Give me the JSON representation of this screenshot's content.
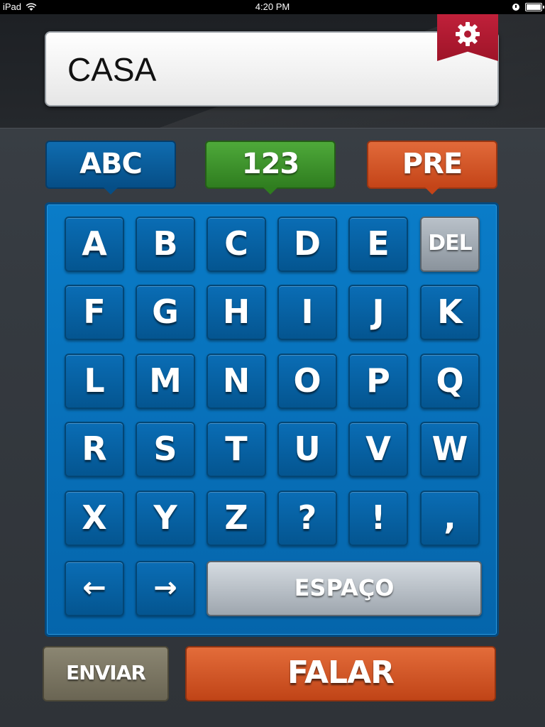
{
  "status_bar": {
    "device": "iPad",
    "time": "4:20 PM"
  },
  "display": {
    "text": "CASA"
  },
  "icons": {
    "settings": "gear-icon",
    "wifi": "wifi-icon",
    "battery": "battery-icon",
    "lock_rotation": "rotation-lock-icon"
  },
  "tabs": [
    {
      "label": "ABC",
      "color": "#0a6db5"
    },
    {
      "label": "123",
      "color": "#3f9a2d"
    },
    {
      "label": "PRE",
      "color": "#d55628"
    }
  ],
  "keys": {
    "row1": [
      "A",
      "B",
      "C",
      "D",
      "E",
      "DEL"
    ],
    "row2": [
      "F",
      "G",
      "H",
      "I",
      "J",
      "K"
    ],
    "row3": [
      "L",
      "M",
      "N",
      "O",
      "P",
      "Q"
    ],
    "row4": [
      "R",
      "S",
      "T",
      "U",
      "V",
      "W"
    ],
    "row5": [
      "X",
      "Y",
      "Z",
      "?",
      "!",
      ","
    ],
    "row6": [
      "←",
      "→"
    ],
    "space": "ESPAÇO"
  },
  "actions": {
    "send": "ENVIAR",
    "speak": "FALAR"
  },
  "colors": {
    "keyboard_blue": "#0a7cc8",
    "settings_red": "#c0203a",
    "speak_orange": "#e36c3a",
    "send_olive": "#8b8672"
  }
}
